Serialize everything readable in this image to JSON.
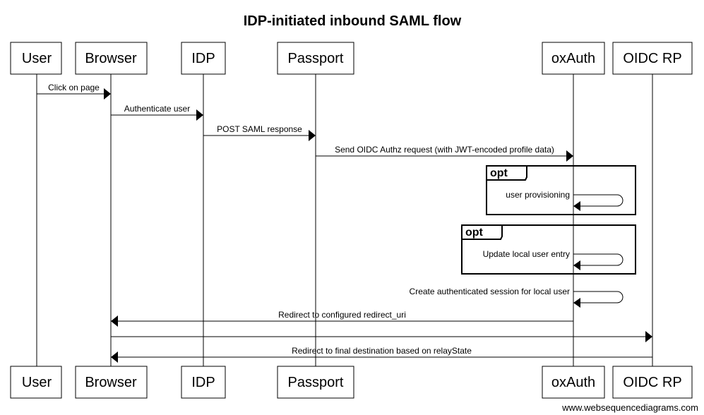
{
  "diagram": {
    "title": "IDP-initiated inbound SAML flow",
    "watermark": "www.websequencediagrams.com",
    "participants": [
      {
        "id": "user",
        "label": "User"
      },
      {
        "id": "browser",
        "label": "Browser"
      },
      {
        "id": "idp",
        "label": "IDP"
      },
      {
        "id": "passport",
        "label": "Passport"
      },
      {
        "id": "oxauth",
        "label": "oxAuth"
      },
      {
        "id": "oidcrp",
        "label": "OIDC RP"
      }
    ],
    "messages": [
      {
        "from": "user",
        "to": "browser",
        "label": "Click on page"
      },
      {
        "from": "browser",
        "to": "idp",
        "label": "Authenticate user"
      },
      {
        "from": "idp",
        "to": "passport",
        "label": "POST SAML response"
      },
      {
        "from": "passport",
        "to": "oxauth",
        "label": "Send OIDC Authz request (with JWT-encoded profile data)"
      },
      {
        "from": "oxauth",
        "to": "oxauth",
        "label": "user provisioning",
        "frame": "opt"
      },
      {
        "from": "oxauth",
        "to": "oxauth",
        "label": "Update local user entry",
        "frame": "opt"
      },
      {
        "from": "oxauth",
        "to": "oxauth",
        "label": "Create authenticated session for local user"
      },
      {
        "from": "oxauth",
        "to": "browser",
        "label": "Redirect to configured redirect_uri"
      },
      {
        "from": "browser",
        "to": "oidcrp",
        "label": ""
      },
      {
        "from": "oidcrp",
        "to": "browser",
        "label": "Redirect to final destination based on relayState"
      }
    ]
  }
}
